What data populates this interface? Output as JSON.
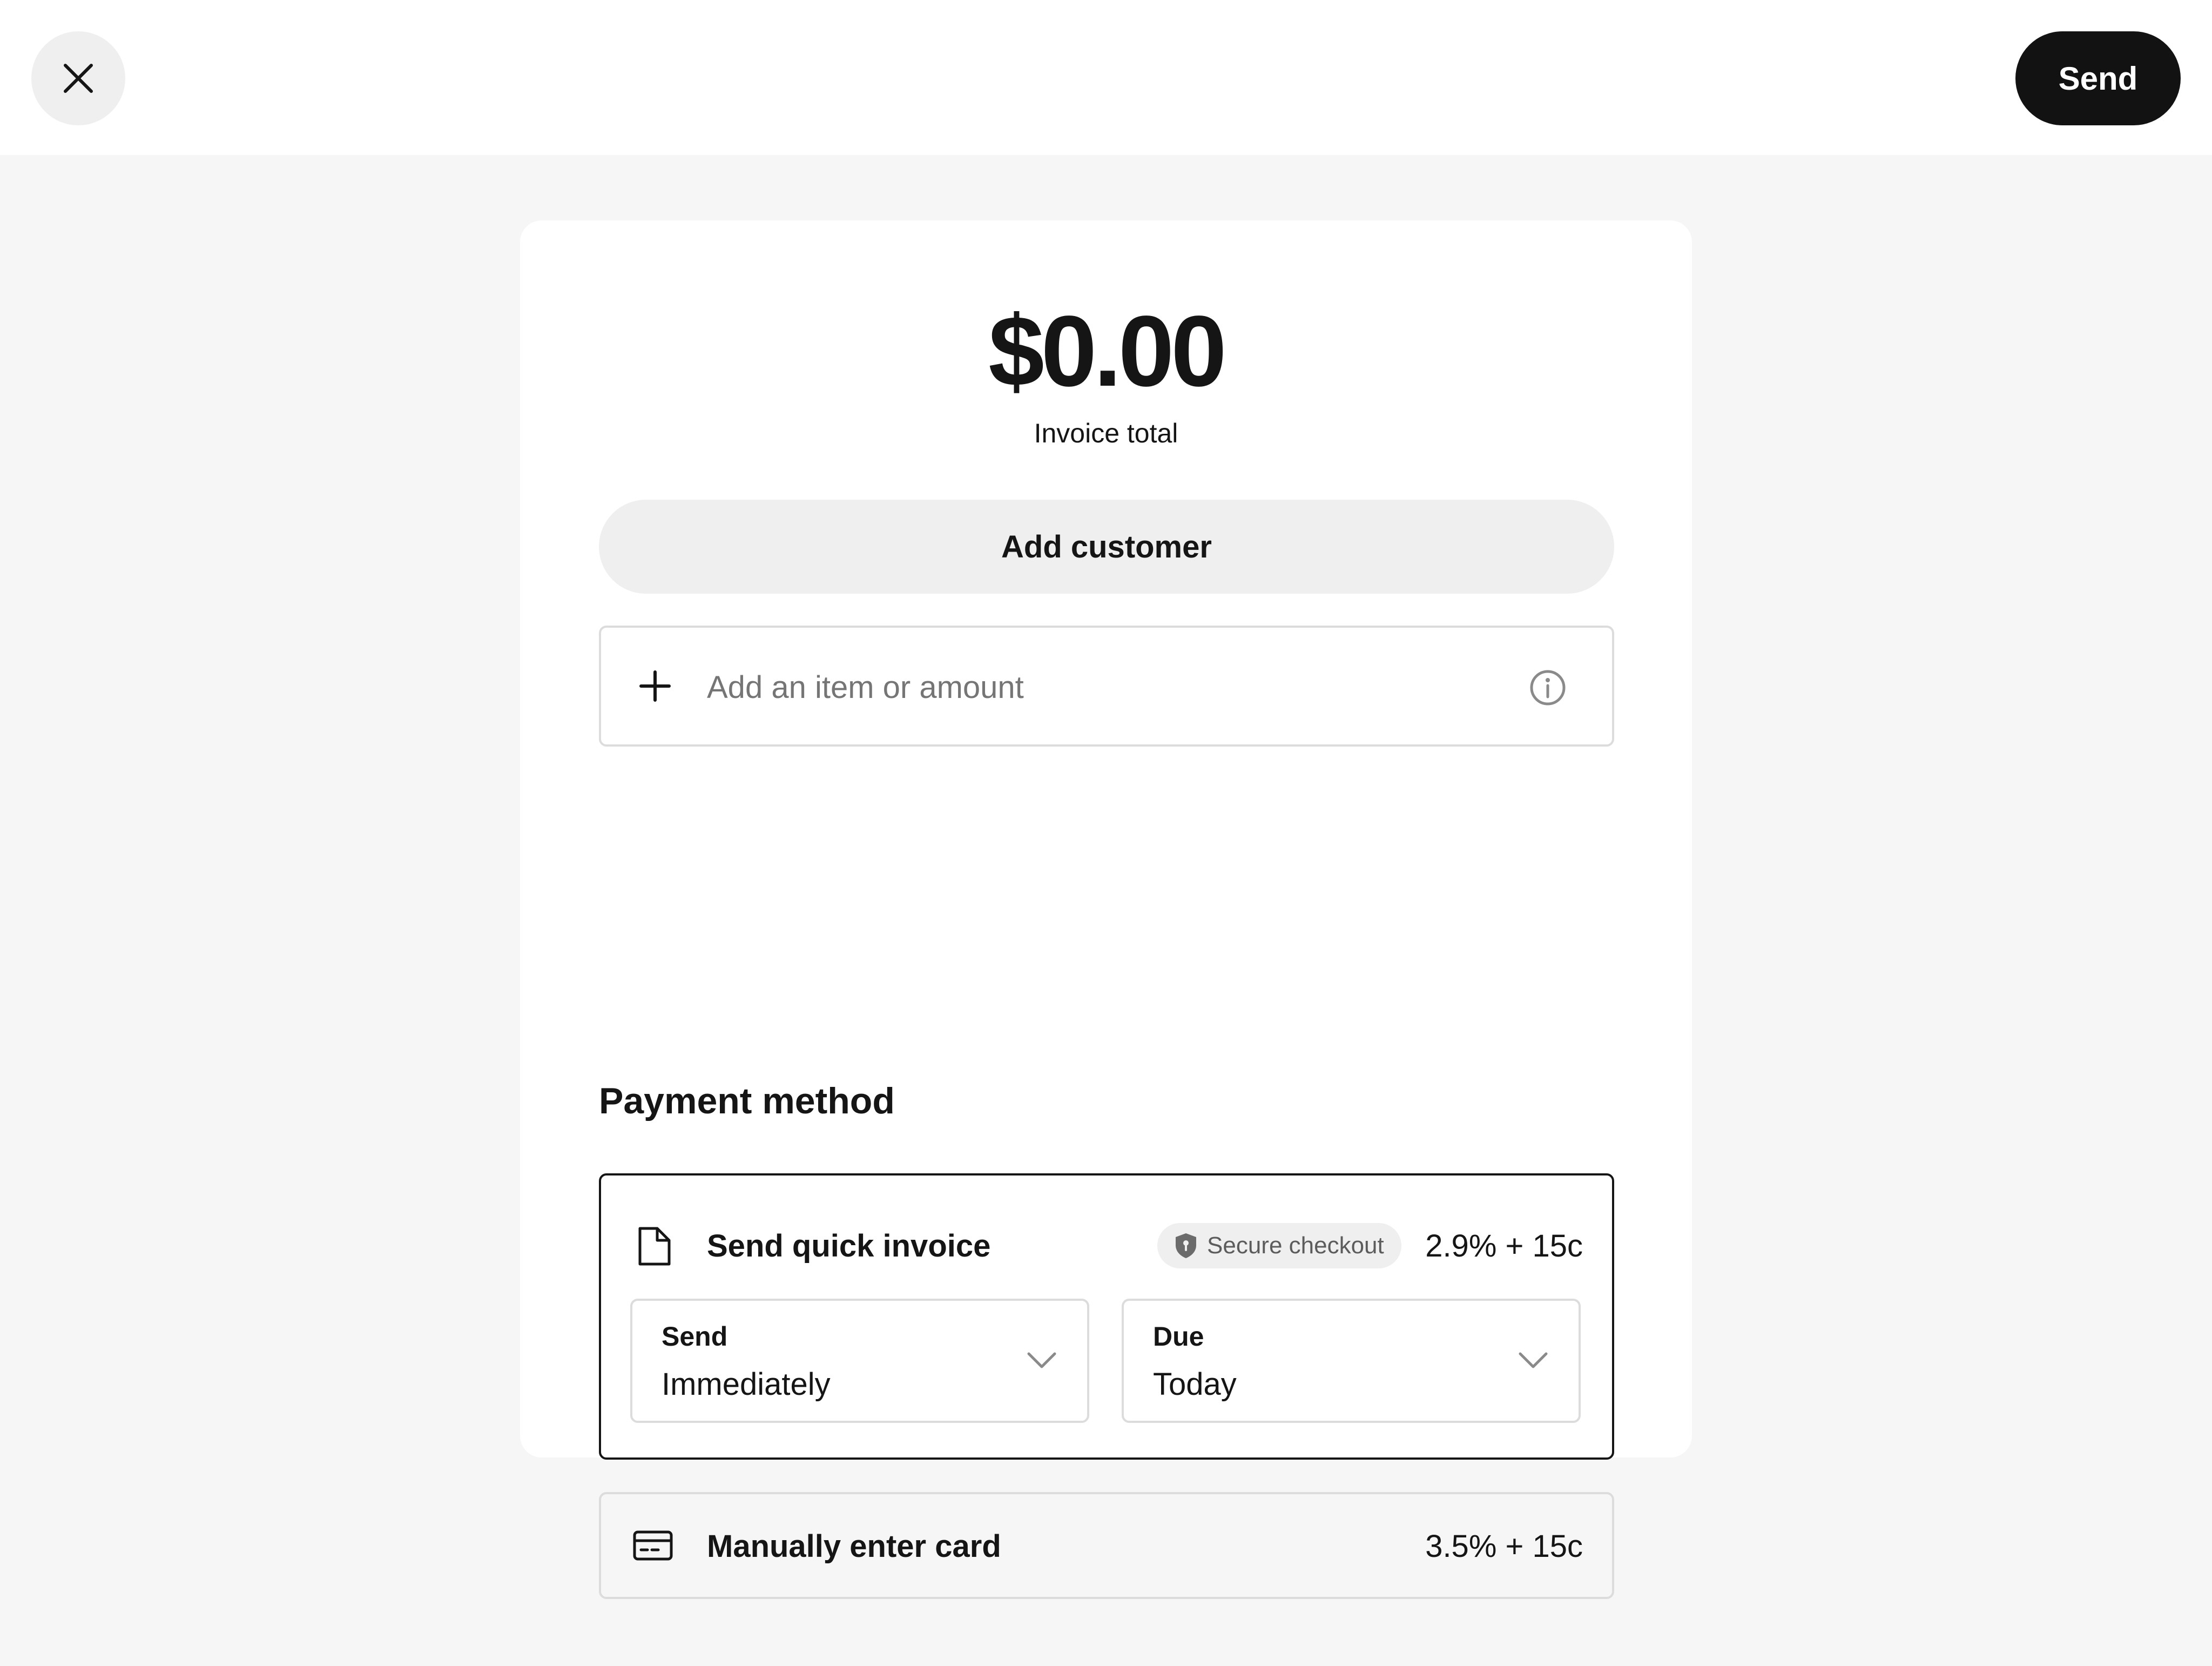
{
  "header": {
    "close_icon": "close-icon",
    "send_label": "Send"
  },
  "invoice": {
    "amount": "$0.00",
    "amount_label": "Invoice total",
    "add_customer_label": "Add customer",
    "item_placeholder": "Add an item or amount",
    "item_value": "",
    "plus_icon": "plus-icon",
    "info_icon": "info-icon"
  },
  "payment": {
    "title": "Payment method",
    "options": [
      {
        "icon": "document-icon",
        "label": "Send quick invoice",
        "badge_icon": "shield-icon",
        "badge": "Secure checkout",
        "fee": "2.9% + 15c",
        "selected": true,
        "send": {
          "label": "Send",
          "value": "Immediately"
        },
        "due": {
          "label": "Due",
          "value": "Today"
        }
      },
      {
        "icon": "credit-card-icon",
        "label": "Manually enter card",
        "fee": "3.5% + 15c",
        "selected": false
      }
    ]
  },
  "colors": {
    "background": "#f6f6f6",
    "surface": "#ffffff",
    "primary": "#121212",
    "muted_fill": "#efefef",
    "border": "#dcdcdc"
  }
}
